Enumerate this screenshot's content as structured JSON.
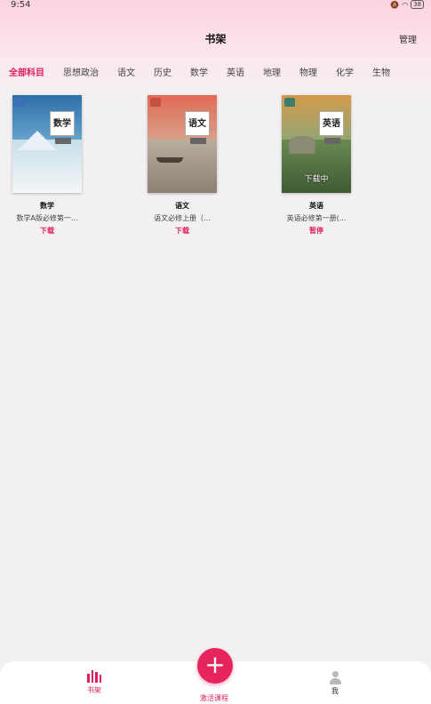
{
  "status": {
    "time": "9:54",
    "battery": "38"
  },
  "header": {
    "title": "书架",
    "manage": "管理"
  },
  "tabs": [
    "全部科目",
    "思想政治",
    "语文",
    "历史",
    "数学",
    "英语",
    "地理",
    "物理",
    "化学",
    "生物"
  ],
  "books": [
    {
      "cover_title": "数学",
      "name": "数学",
      "desc": "数学A版必修第一...",
      "action": "下载",
      "overlay": ""
    },
    {
      "cover_title": "语文",
      "name": "语文",
      "desc": "语文必修上册（...",
      "action": "下载",
      "overlay": ""
    },
    {
      "cover_title": "英语",
      "name": "英语",
      "desc": "英语必修第一册(...",
      "action": "暂停",
      "overlay": "下载中"
    }
  ],
  "bottom_nav": {
    "shelf": "书架",
    "activate": "激活课程",
    "me": "我",
    "fab": "+"
  },
  "colors": {
    "accent": "#e01e5a",
    "fab": "#e8245d"
  }
}
